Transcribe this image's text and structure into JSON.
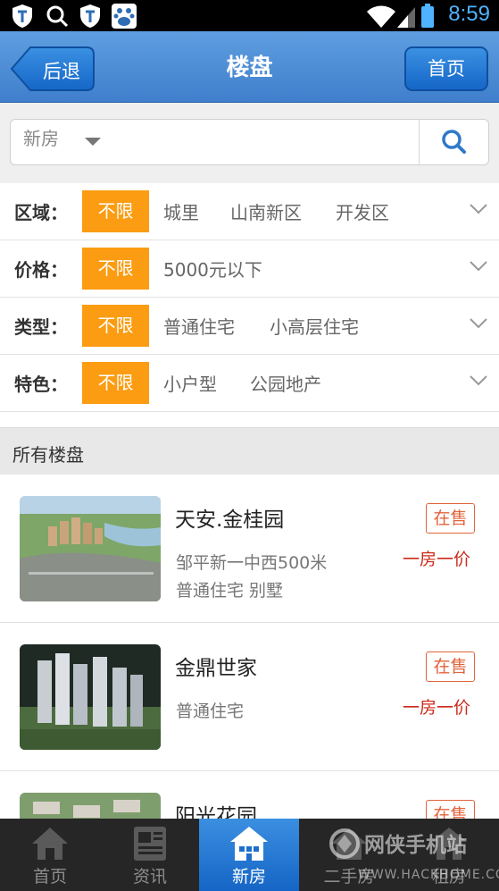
{
  "status_bar": {
    "time": "8:59",
    "icons": [
      "shield-icon",
      "search-icon",
      "shield-icon",
      "baidu-icon",
      "wifi-icon",
      "signal-icon",
      "battery-icon"
    ]
  },
  "header": {
    "back_label": "后退",
    "title": "楼盘",
    "home_label": "首页"
  },
  "search": {
    "category_value": "新房"
  },
  "filters": [
    {
      "label": "区域：",
      "selected": "不限",
      "options": [
        "城里",
        "山南新区",
        "开发区"
      ]
    },
    {
      "label": "价格：",
      "selected": "不限",
      "options": [
        "5000元以下"
      ]
    },
    {
      "label": "类型：",
      "selected": "不限",
      "options": [
        "普通住宅",
        "小高层住宅"
      ]
    },
    {
      "label": "特色：",
      "selected": "不限",
      "options": [
        "小户型",
        "公园地产"
      ]
    }
  ],
  "section": {
    "title": "所有楼盘"
  },
  "listings": [
    {
      "name": "天安.金桂园",
      "lines": [
        "邹平新一中西500米",
        "普通住宅 别墅"
      ],
      "status": "在售",
      "price_note": "一房一价"
    },
    {
      "name": "金鼎世家",
      "lines": [
        "普通住宅"
      ],
      "status": "在售",
      "price_note": "一房一价"
    },
    {
      "name": "阳光花园",
      "lines": [],
      "status": "在售",
      "price_note": ""
    }
  ],
  "tabbar": {
    "tabs": [
      {
        "label": "首页",
        "icon": "home-icon"
      },
      {
        "label": "资讯",
        "icon": "news-icon"
      },
      {
        "label": "新房",
        "icon": "building-icon",
        "active": true
      },
      {
        "label": "二手房",
        "icon": "house-icon"
      },
      {
        "label": "租房",
        "icon": "rent-icon"
      }
    ]
  },
  "watermark": {
    "text": "网侠手机站",
    "sub": "WWW.HACKHOME.COM"
  },
  "colors": {
    "header_blue": "#4a8bd4",
    "accent_orange": "#fb9c12",
    "status_red": "#e0643c",
    "price_red": "#cc2a1a"
  }
}
